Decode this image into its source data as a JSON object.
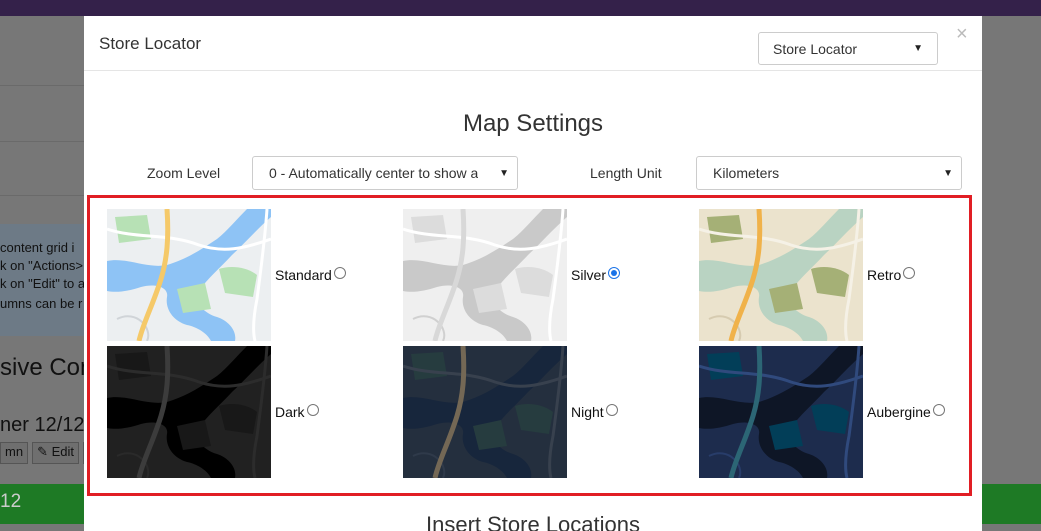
{
  "background": {
    "text_lines": [
      "content grid i",
      "k on \"Actions>",
      "k on \"Edit\" to a",
      "umns can be r"
    ],
    "heading": "sive Con",
    "subheading": "ner 12/12",
    "toolbar": [
      "mn",
      "✎ Edit",
      "✖"
    ],
    "green_bar_text": "12"
  },
  "modal": {
    "title": "Store Locator",
    "header_select": {
      "value": "Store Locator"
    },
    "close_label": "×",
    "section_title": "Map Settings",
    "zoom": {
      "label": "Zoom Level",
      "value": "0 - Automatically center to show a"
    },
    "length_unit": {
      "label": "Length Unit",
      "value": "Kilometers"
    },
    "map_styles": [
      {
        "label": "Standard",
        "selected": false,
        "colors": {
          "land": "#eceff1",
          "water": "#8ec3f5",
          "park": "#b7e1b5",
          "road": "#ffffff",
          "highway": "#f5c969",
          "outline": "#d0d4d8"
        }
      },
      {
        "label": "Silver",
        "selected": true,
        "colors": {
          "land": "#efefef",
          "water": "#c9c9c9",
          "park": "#dcdcdc",
          "road": "#ffffff",
          "highway": "#d8d8d8",
          "outline": "#d0d0d0"
        }
      },
      {
        "label": "Retro",
        "selected": false,
        "colors": {
          "land": "#ebe3cd",
          "water": "#b9d3c2",
          "park": "#a5b076",
          "road": "#f5f1e6",
          "highway": "#f0b24a",
          "outline": "#d6cbb0"
        }
      },
      {
        "label": "Dark",
        "selected": false,
        "colors": {
          "land": "#212121",
          "water": "#000000",
          "park": "#181818",
          "road": "#2c2c2c",
          "highway": "#3c3c3c",
          "outline": "#2a2a2a"
        }
      },
      {
        "label": "Night",
        "selected": false,
        "colors": {
          "land": "#242f3e",
          "water": "#17263c",
          "park": "#263c3f",
          "road": "#38414e",
          "highway": "#746855",
          "outline": "#2f3a4a"
        }
      },
      {
        "label": "Aubergine",
        "selected": false,
        "colors": {
          "land": "#1d2c4d",
          "water": "#0e1626",
          "park": "#023e58",
          "road": "#304a7d",
          "highway": "#2c6675",
          "outline": "#283d6a"
        }
      }
    ],
    "bottom_title": "Insert Store Locations"
  }
}
